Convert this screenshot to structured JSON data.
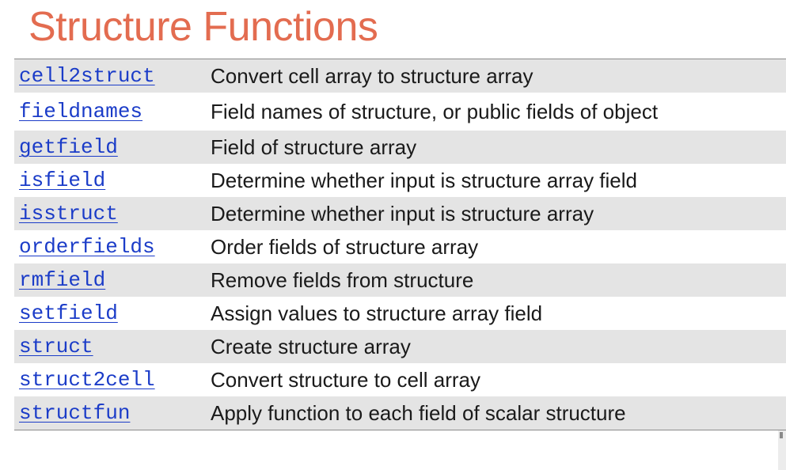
{
  "title": "Structure Functions",
  "colors": {
    "title": "#e36c50",
    "link": "#1b3cc8",
    "row_shade": "#e4e4e4"
  },
  "rows": [
    {
      "fn": "cell2struct",
      "desc": "Convert cell array to structure array"
    },
    {
      "fn": "fieldnames",
      "desc": "Field names of structure, or public fields of object"
    },
    {
      "fn": "getfield",
      "desc": "Field of structure array"
    },
    {
      "fn": "isfield",
      "desc": "Determine whether input is structure array field"
    },
    {
      "fn": "isstruct",
      "desc": "Determine whether input is structure array"
    },
    {
      "fn": "orderfields",
      "desc": "Order fields of structure array"
    },
    {
      "fn": "rmfield",
      "desc": "Remove fields from structure"
    },
    {
      "fn": "setfield",
      "desc": "Assign values to structure array field"
    },
    {
      "fn": "struct",
      "desc": "Create structure array"
    },
    {
      "fn": "struct2cell",
      "desc": "Convert structure to cell array"
    },
    {
      "fn": "structfun",
      "desc": "Apply function to each field of scalar structure"
    }
  ]
}
